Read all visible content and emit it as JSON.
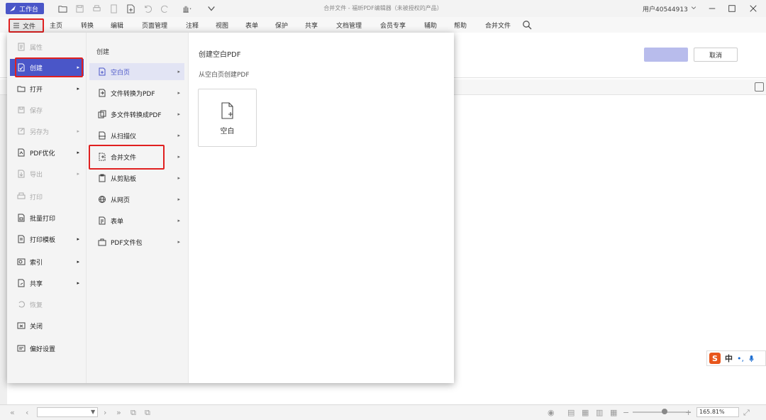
{
  "titlebar": {
    "workbench_label": "工作台",
    "window_title": "合并文件 - 福昕PDF编辑器（未被授权的产品）",
    "user": "用户40544913"
  },
  "tabs": {
    "file": "文件",
    "items": [
      "主页",
      "转换",
      "编辑",
      "页面管理",
      "注释",
      "视图",
      "表单",
      "保护",
      "共享",
      "文档管理",
      "会员专享",
      "辅助",
      "帮助",
      "合并文件"
    ]
  },
  "ribbon": {
    "cancel_label": "取消"
  },
  "file_menu": {
    "items": [
      {
        "label": "属性",
        "icon": "properties-icon"
      },
      {
        "label": "创建",
        "icon": "create-icon"
      },
      {
        "label": "打开",
        "icon": "open-icon"
      },
      {
        "label": "保存",
        "icon": "save-icon"
      },
      {
        "label": "另存为",
        "icon": "save-as-icon"
      },
      {
        "label": "PDF优化",
        "icon": "optimize-icon"
      },
      {
        "label": "导出",
        "icon": "export-icon"
      },
      {
        "label": "打印",
        "icon": "print-icon"
      },
      {
        "label": "批量打印",
        "icon": "batch-print-icon"
      },
      {
        "label": "打印模板",
        "icon": "print-template-icon"
      },
      {
        "label": "索引",
        "icon": "index-icon"
      },
      {
        "label": "共享",
        "icon": "share-icon"
      },
      {
        "label": "恢复",
        "icon": "restore-icon"
      },
      {
        "label": "关闭",
        "icon": "close-icon"
      },
      {
        "label": "偏好设置",
        "icon": "preferences-icon"
      }
    ]
  },
  "create_menu": {
    "title": "创建",
    "items": [
      {
        "label": "空白页",
        "icon": "blank-page-icon"
      },
      {
        "label": "文件转换为PDF",
        "icon": "file-to-pdf-icon"
      },
      {
        "label": "多文件转换成PDF",
        "icon": "multi-file-to-pdf-icon"
      },
      {
        "label": "从扫描仪",
        "icon": "scanner-icon"
      },
      {
        "label": "合并文件",
        "icon": "merge-files-icon"
      },
      {
        "label": "从剪贴板",
        "icon": "clipboard-icon"
      },
      {
        "label": "从网页",
        "icon": "web-page-icon"
      },
      {
        "label": "表单",
        "icon": "form-icon"
      },
      {
        "label": "PDF文件包",
        "icon": "pdf-portfolio-icon"
      }
    ]
  },
  "create_panel": {
    "title": "创建空白PDF",
    "subtitle": "从空白页创建PDF",
    "card_label": "空白"
  },
  "ime": {
    "logo": "S",
    "lang": "中"
  },
  "statusbar": {
    "zoom": "165.81%",
    "zoom_fraction": 0.55
  },
  "colors": {
    "accent": "#4a56c8",
    "highlight_box": "#e02020",
    "menu_bg": "#f4f4f4"
  }
}
